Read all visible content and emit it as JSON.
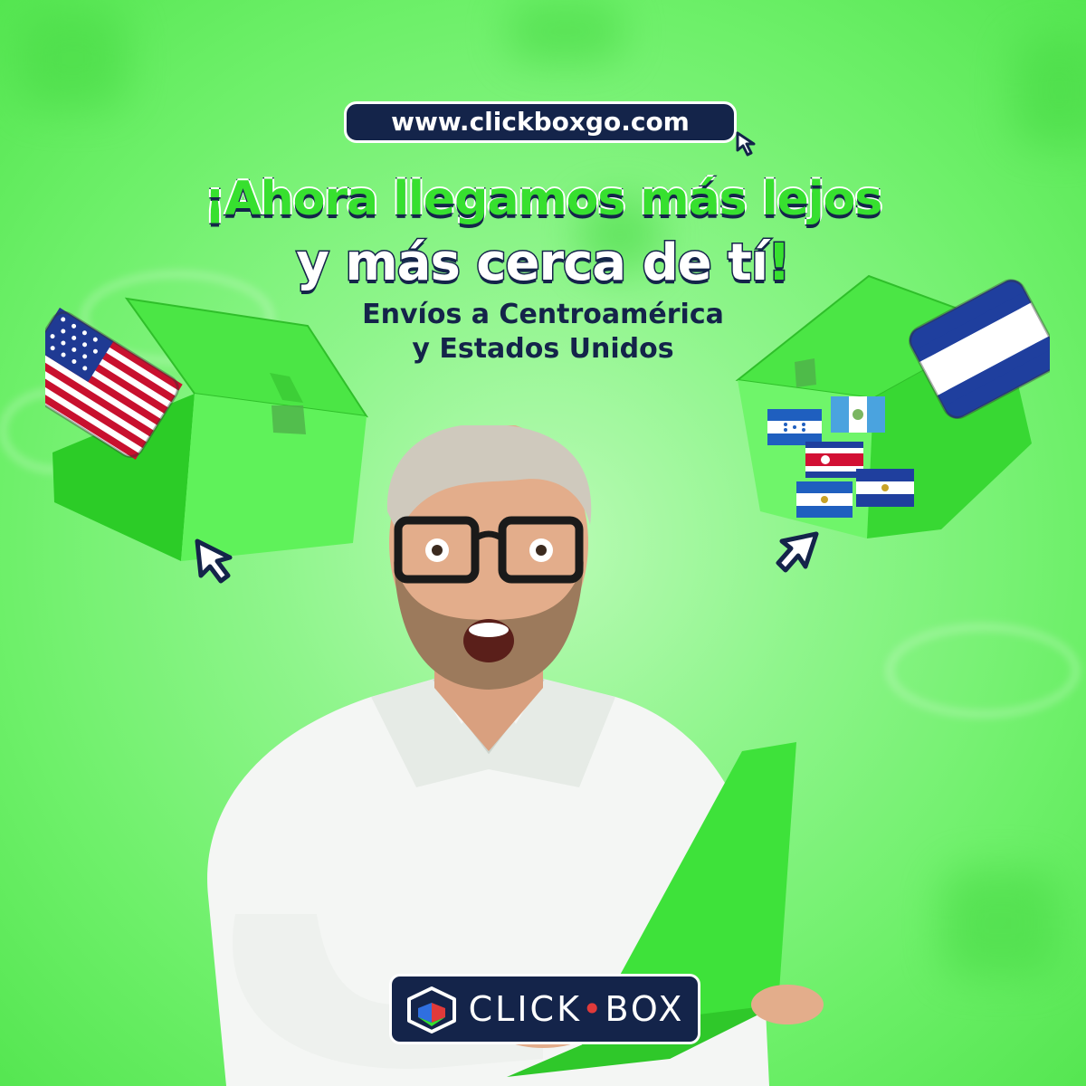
{
  "website": {
    "url": "www.clickboxgo.com"
  },
  "headline": {
    "line1": "¡Ahora llegamos más lejos",
    "line2_main": "y más cerca de tí",
    "line2_end": "!"
  },
  "subheadline": {
    "line1": "Envíos a Centroamérica",
    "line2": "y Estados Unidos"
  },
  "brand": {
    "name_part1": "CLICK",
    "separator": "•",
    "name_part2": "BOX"
  },
  "colors": {
    "background": "#7ef27a",
    "navy": "#14244a",
    "green": "#37e02f",
    "box_green": "#3fdc3a"
  },
  "icons": [
    "cursor-arrow-icon",
    "us-flag-icon",
    "honduras-flag-icon",
    "guatemala-flag-icon",
    "costa-rica-flag-icon",
    "nicaragua-flag-icon",
    "el-salvador-flag-icon",
    "clickbox-logo-icon"
  ]
}
